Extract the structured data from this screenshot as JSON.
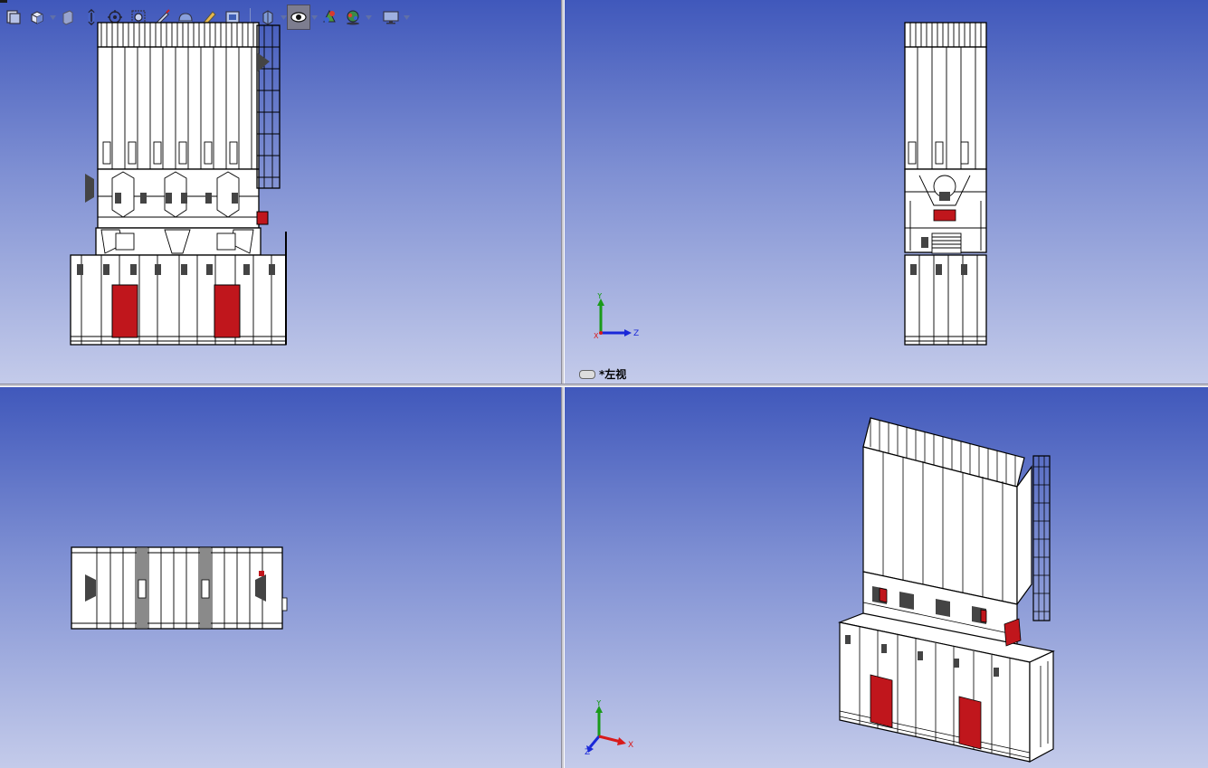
{
  "toolbar": {
    "buttons": [
      {
        "name": "previous-view-icon",
        "active": false
      },
      {
        "name": "view-orientation-icon",
        "active": false,
        "dropdown": true
      },
      {
        "name": "section-view-icon",
        "active": false
      },
      {
        "name": "rotate-view-icon",
        "active": false
      },
      {
        "name": "pan-view-icon",
        "active": false
      },
      {
        "name": "zoom-to-fit-icon",
        "active": false
      },
      {
        "name": "sketch-tool-icon",
        "active": false
      },
      {
        "name": "display-style-icon",
        "active": false
      },
      {
        "name": "edit-appearance-icon",
        "active": false
      },
      {
        "name": "apply-scene-icon",
        "active": false
      },
      {
        "name": "hide-show-items-icon",
        "active": false,
        "dropdown": true
      },
      {
        "name": "view-visibility-icon",
        "active": true,
        "dropdown": true
      },
      {
        "name": "realview-graphics-icon",
        "active": false
      },
      {
        "name": "shadows-icon",
        "active": false,
        "dropdown": true
      },
      {
        "name": "view-settings-icon",
        "active": false,
        "dropdown": true
      }
    ]
  },
  "viewports": {
    "top_left": {
      "view": "front"
    },
    "top_right": {
      "view": "left",
      "label": "*左视",
      "triad": {
        "y": "Y",
        "z": "Z",
        "x": "X"
      }
    },
    "bottom_left": {
      "view": "top"
    },
    "bottom_right": {
      "view": "isometric",
      "triad": {
        "y": "Y",
        "z": "Z",
        "x": "X"
      }
    }
  },
  "colors": {
    "viewport_top": "#4058bb",
    "viewport_bottom": "#c4cbea",
    "door_red": "#c0161c",
    "panel_white": "#ffffff",
    "outline": "#000000",
    "axis_y": "#1a9a1a",
    "axis_z": "#1a28d8",
    "axis_x": "#d81a1a"
  }
}
